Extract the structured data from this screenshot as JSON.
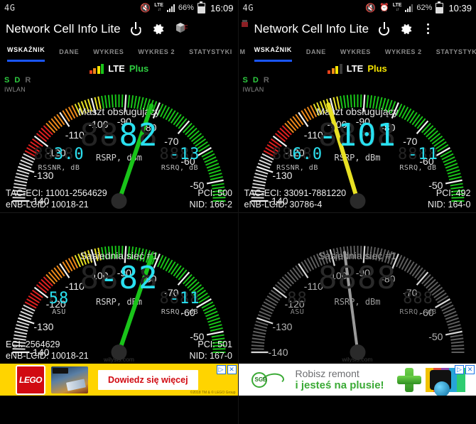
{
  "panels": [
    {
      "status": {
        "network": "4G",
        "mute_icon": "mute-icon",
        "alarm": false,
        "lte_label": "LTE",
        "battery": "66%",
        "time": "16:09",
        "signal_bars": 4
      },
      "appbar": {
        "title": "Network Cell Info Lite",
        "power_icon": "power-icon",
        "gear_icon": "gear-icon",
        "overflow": false,
        "logo": true
      },
      "tabs": {
        "items": [
          "WSKAŹNIK",
          "DANE",
          "WYKRES",
          "WYKRES 2",
          "STATYSTYKI"
        ],
        "active": 0,
        "edge": "M"
      },
      "serving": {
        "sdr": "S D R",
        "sdr_active": [
          "S",
          "D"
        ],
        "iwlan": "IWLAN",
        "net_type": "LTE",
        "net_name": "Plus",
        "net_name_color": "#2ecc40",
        "signal_bars_lit": 4,
        "title": "Maszt obsługujący",
        "value": "-82",
        "value_digits": 4,
        "needle_color": "#19c419",
        "needle_value": -82,
        "value_label": "RSRP, dBm",
        "left": {
          "value": "3.0",
          "digits": 5,
          "caption": "RSSNR, dB"
        },
        "right": {
          "value": "-13",
          "digits": 4,
          "caption": "RSRQ, dB"
        },
        "info": [
          [
            "TAC-ECI: 11001-2564629",
            "PCI: 500"
          ],
          [
            "eNB-LCID: 10018-21",
            "NID: 166-2"
          ]
        ]
      },
      "neighbor": {
        "title": "Sąsiednia sieć #1",
        "value": "-82",
        "value_digits": 4,
        "needle_color": "#19c419",
        "needle_value": -82,
        "active": true,
        "value_label": "RSRP, dBm",
        "left": {
          "value": "58",
          "digits": 2,
          "caption": "ASU"
        },
        "right": {
          "value": "-11",
          "digits": 4,
          "caption": "RSRQ, dB"
        },
        "info": [
          [
            "ECI: 2564629",
            "PCI: 501"
          ],
          [
            "eNB-LCID: 10018-21",
            "NID: 167-0"
          ]
        ],
        "watermark": "wilysis.com"
      },
      "ad": {
        "type": "lego",
        "brand": "LEGO",
        "cta": "Dowiedz się więcej",
        "fine": "©2018 TM & © LEGO Group",
        "controls": [
          "▷",
          "✕"
        ]
      }
    },
    {
      "status": {
        "network": "4G",
        "mute_icon": "mute-icon",
        "alarm": true,
        "lte_label": "LTE",
        "battery": "62%",
        "time": "10:39",
        "signal_bars": 3
      },
      "appbar": {
        "title": "Network Cell Info Lite",
        "power_icon": "power-icon",
        "gear_icon": "gear-icon",
        "overflow": true,
        "logo": true
      },
      "tabs": {
        "items": [
          "WSKAŹNIK",
          "DANE",
          "WYKRES",
          "WYKRES 2",
          "STATYSTYKI"
        ],
        "active": 0,
        "edge": "M"
      },
      "serving": {
        "sdr": "S D R",
        "sdr_active": [
          "S",
          "D"
        ],
        "iwlan": "IWLAN",
        "net_type": "LTE",
        "net_name": "Plus",
        "net_name_color": "#f5e400",
        "signal_bars_lit": 3,
        "title": "Maszt obsługujący",
        "value": "-101",
        "value_digits": 4,
        "needle_color": "#e8e123",
        "needle_value": -101,
        "value_label": "RSRP, dBm",
        "left": {
          "value": "6.0",
          "digits": 5,
          "caption": "RSSNR, dB"
        },
        "right": {
          "value": "-11",
          "digits": 4,
          "caption": "RSRQ, dB"
        },
        "info": [
          [
            "TAC-ECI: 33091-7881220",
            "PCI: 492"
          ],
          [
            "eNB-LCID: 30786-4",
            "NID: 164-0"
          ]
        ]
      },
      "neighbor": {
        "title": "Sąsiednia sieć #1",
        "value": "",
        "value_digits": 4,
        "needle_color": "#9a9a9a",
        "needle_value": -96,
        "active": false,
        "value_label": "RSRP, dBm",
        "left": {
          "value": "",
          "digits": 2,
          "caption": "ASU"
        },
        "right": {
          "value": "",
          "digits": 3,
          "caption": "RSRQ, dB"
        },
        "info": [],
        "watermark": "wilysis.com"
      },
      "ad": {
        "type": "sgb",
        "brand": "SGB",
        "line1": "Robisz remont",
        "line2": "i jesteś na plusie!",
        "controls": [
          "▷",
          "✕"
        ]
      }
    }
  ],
  "gauge_scale": {
    "ticks": [
      -140,
      -130,
      -120,
      -110,
      -100,
      -90,
      -80,
      -70,
      -60,
      -50
    ],
    "min": -140,
    "max": -44,
    "colors": {
      "low": "#d8d8d8",
      "red": "#e02020",
      "orange": "#ef8a1a",
      "yellow": "#e8e123",
      "green": "#19c419"
    }
  }
}
